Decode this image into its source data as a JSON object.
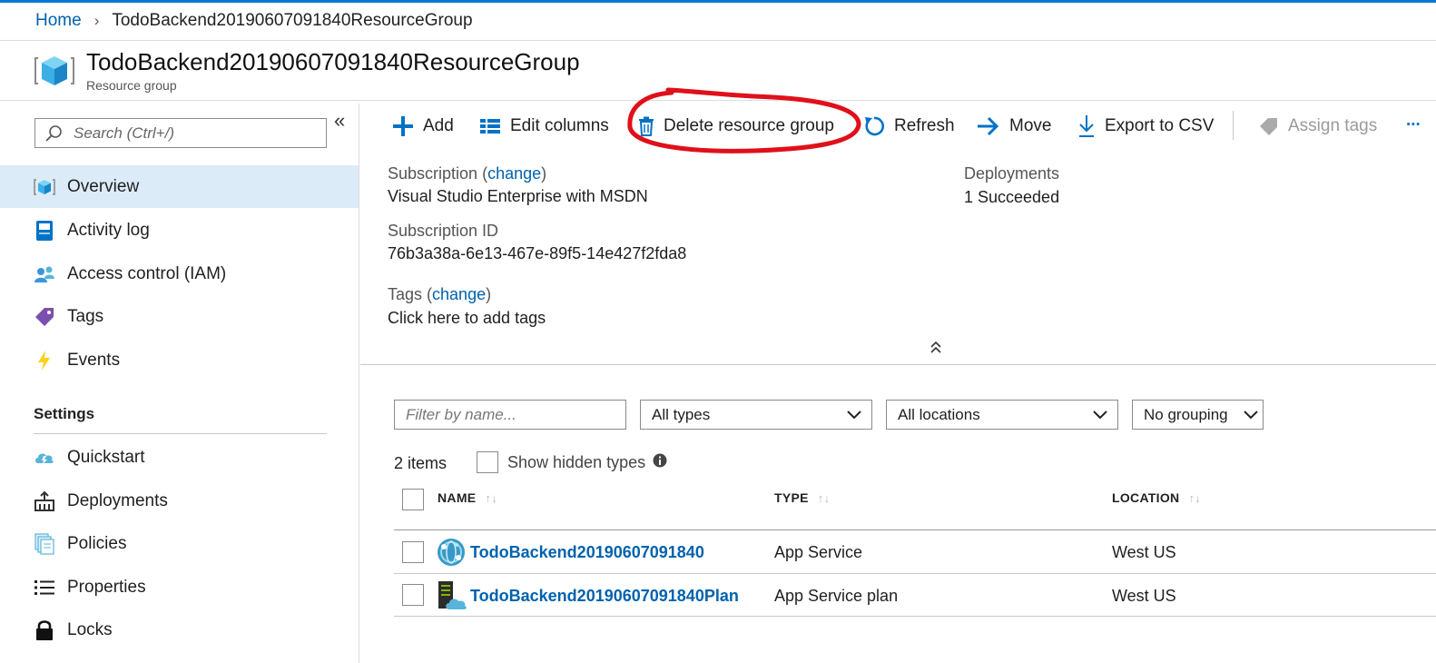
{
  "breadcrumb": {
    "home": "Home",
    "current": "TodoBackend20190607091840ResourceGroup"
  },
  "header": {
    "title": "TodoBackend20190607091840ResourceGroup",
    "subtitle": "Resource group"
  },
  "sidebar": {
    "search_placeholder": "Search (Ctrl+/)",
    "items": [
      {
        "label": "Overview",
        "icon": "resource-group-icon",
        "active": true
      },
      {
        "label": "Activity log",
        "icon": "activity-log-icon"
      },
      {
        "label": "Access control (IAM)",
        "icon": "people-icon"
      },
      {
        "label": "Tags",
        "icon": "tag-icon"
      },
      {
        "label": "Events",
        "icon": "lightning-icon"
      }
    ],
    "settings_title": "Settings",
    "settings_items": [
      {
        "label": "Quickstart",
        "icon": "cloud-quickstart-icon"
      },
      {
        "label": "Deployments",
        "icon": "deployments-icon"
      },
      {
        "label": "Policies",
        "icon": "policies-icon"
      },
      {
        "label": "Properties",
        "icon": "properties-icon"
      },
      {
        "label": "Locks",
        "icon": "lock-icon"
      }
    ]
  },
  "toolbar": {
    "add": "Add",
    "edit_columns": "Edit columns",
    "delete": "Delete resource group",
    "refresh": "Refresh",
    "move": "Move",
    "export": "Export to CSV",
    "assign_tags": "Assign tags",
    "more": "..."
  },
  "essentials": {
    "subscription_label": "Subscription",
    "change": "change",
    "subscription_value": "Visual Studio Enterprise with MSDN",
    "subscription_id_label": "Subscription ID",
    "subscription_id": "76b3a38a-6e13-467e-89f5-14e427f2fda8",
    "tags_label": "Tags",
    "tags_link": "Click here to add tags",
    "deployments_label": "Deployments",
    "deployments_value": "1 Succeeded"
  },
  "filters": {
    "name_placeholder": "Filter by name...",
    "types": "All types",
    "locations": "All locations",
    "grouping": "No grouping"
  },
  "list": {
    "count": "2 items",
    "show_hidden": "Show hidden types",
    "columns": {
      "name": "NAME",
      "type": "TYPE",
      "location": "LOCATION"
    },
    "rows": [
      {
        "name": "TodoBackend20190607091840",
        "type": "App Service",
        "location": "West US",
        "icon": "app-service-icon"
      },
      {
        "name": "TodoBackend20190607091840Plan",
        "type": "App Service plan",
        "location": "West US",
        "icon": "app-service-plan-icon"
      }
    ]
  },
  "colors": {
    "accent": "#0078d4",
    "link": "#0062ad",
    "active_bg": "#dcebf8",
    "annotation": "#e0101a"
  }
}
